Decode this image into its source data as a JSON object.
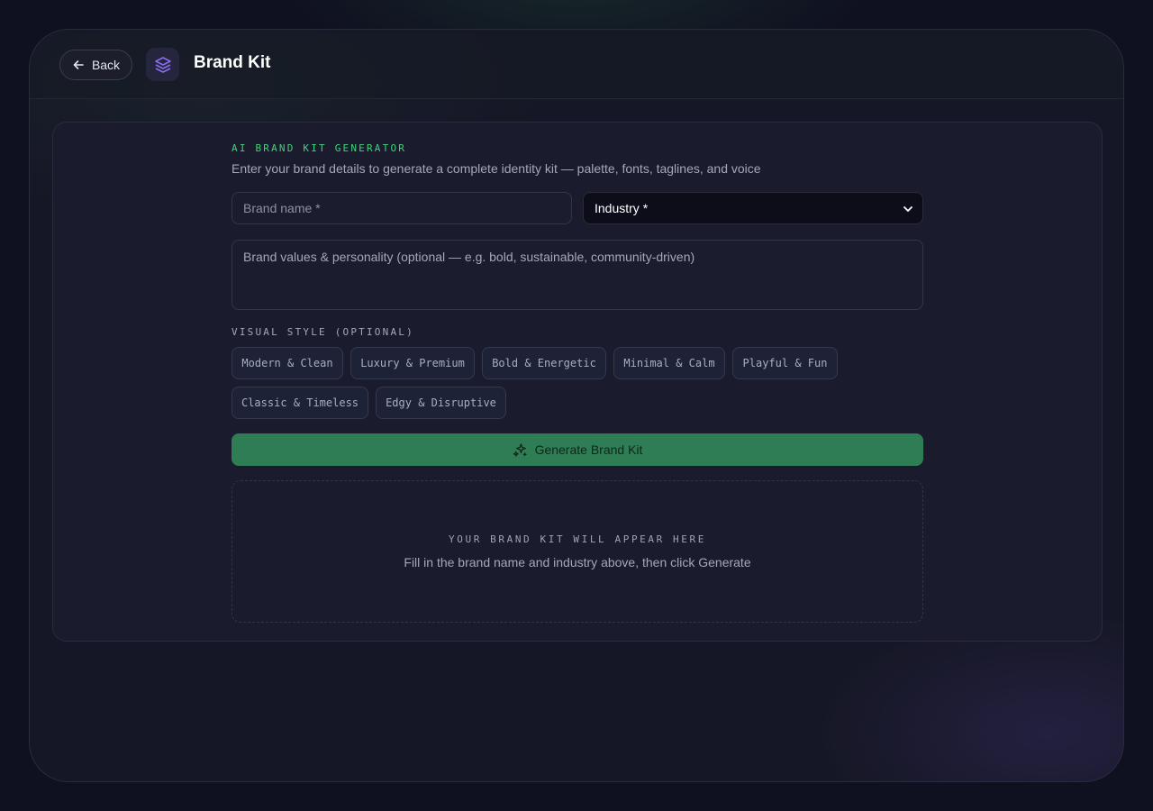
{
  "header": {
    "back_label": "Back",
    "title": "Brand Kit"
  },
  "form": {
    "eyebrow": "AI BRAND KIT GENERATOR",
    "subtitle": "Enter your brand details to generate a complete identity kit — palette, fonts, taglines, and voice",
    "brand_name_placeholder": "Brand name *",
    "industry_selected": "Industry *",
    "values_placeholder": "Brand values & personality (optional — e.g. bold, sustainable, community-driven)",
    "style_label": "VISUAL STYLE (OPTIONAL)",
    "styles": [
      "Modern & Clean",
      "Luxury & Premium",
      "Bold & Energetic",
      "Minimal & Calm",
      "Playful & Fun",
      "Classic & Timeless",
      "Edgy & Disruptive"
    ],
    "generate_label": "Generate Brand Kit"
  },
  "result": {
    "title": "YOUR BRAND KIT WILL APPEAR HERE",
    "hint": "Fill in the brand name and industry above, then click Generate"
  },
  "icons": {
    "back": "arrow-left-icon",
    "logo": "layers-icon",
    "generate": "sparkles-icon",
    "select": "chevron-down-icon"
  },
  "colors": {
    "accent_green": "#3ed47a",
    "button_green": "#2f7d55",
    "logo_purple": "#8b6cf0"
  }
}
